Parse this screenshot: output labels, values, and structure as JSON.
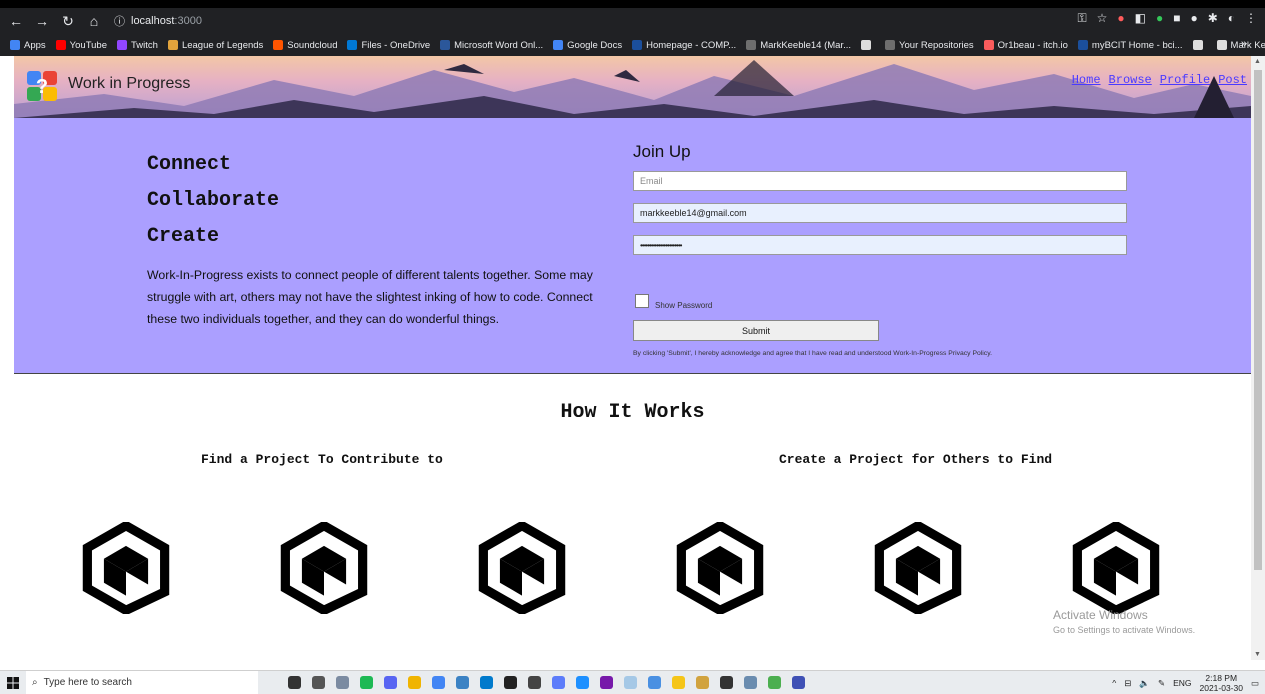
{
  "browser": {
    "url_host": "localhost",
    "url_port": ":3000",
    "bookmarks": [
      {
        "label": "Apps",
        "color": "#4285f4"
      },
      {
        "label": "YouTube",
        "color": "#ff0000"
      },
      {
        "label": "Twitch",
        "color": "#9146ff"
      },
      {
        "label": "League of Legends",
        "color": "#e2a33c"
      },
      {
        "label": "Soundcloud",
        "color": "#ff5500"
      },
      {
        "label": "Files - OneDrive",
        "color": "#0078d4"
      },
      {
        "label": "Microsoft Word Onl...",
        "color": "#2b579a"
      },
      {
        "label": "Google Docs",
        "color": "#4285f4"
      },
      {
        "label": "Homepage - COMP...",
        "color": "#1b4f9c"
      },
      {
        "label": "MarkKeeble14 (Mar...",
        "color": "#6e6e6e"
      },
      {
        "label": "",
        "color": "#dddddd"
      },
      {
        "label": "Your Repositories",
        "color": "#6e6e6e"
      },
      {
        "label": "Or1beau - itch.io",
        "color": "#fa5c5c"
      },
      {
        "label": "myBCIT Home - bci...",
        "color": "#1b4f9c"
      },
      {
        "label": "",
        "color": "#dddddd"
      },
      {
        "label": "Mark Keeble | Cour...",
        "color": "#dddddd"
      }
    ],
    "more": "»"
  },
  "site": {
    "brand": "Work in Progress",
    "nav": [
      "Home",
      "Browse",
      "Profile",
      "Post"
    ],
    "taglines": [
      "Connect",
      "Collaborate",
      "Create"
    ],
    "intro": "Work-In-Progress exists to connect people of different talents together. Some may struggle with art, others may not have the slightest inking of how to code. Connect these two individuals together, and they can do wonderful things.",
    "form": {
      "title": "Join Up",
      "email_placeholder": "Email",
      "username_value": "markkeeble14@gmail.com",
      "password_value": "•••••••••••••••••••••••",
      "show_password_label": "Show Password",
      "submit_label": "Submit",
      "disclaimer": "By clicking 'Submit', I hereby acknowledge and agree that I have read and understood Work-In-Progress Privacy Policy."
    },
    "how_title": "How It Works",
    "col_left": "Find a Project To Contribute to",
    "col_right": "Create a Project for Others to Find",
    "watermark_title": "Activate Windows",
    "watermark_sub": "Go to Settings to activate Windows."
  },
  "taskbar": {
    "search_placeholder": "Type here to search",
    "lang": "ENG",
    "time": "2:18 PM",
    "date": "2021-03-30"
  },
  "colors": {
    "hero_bg": "#ab9fff",
    "nav_link": "#4a3aff"
  }
}
